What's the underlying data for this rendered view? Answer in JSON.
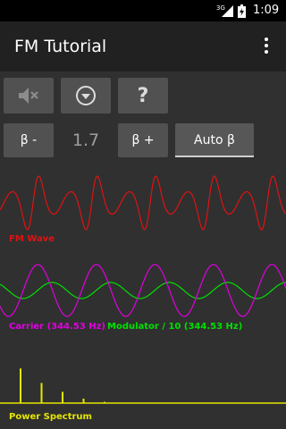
{
  "status_bar": {
    "network": "3G",
    "time": "1:09"
  },
  "app_bar": {
    "title": "FM Tutorial",
    "overflow_icon": "more-vert-icon"
  },
  "controls": {
    "mute_icon": "volume-off-icon",
    "menu_icon": "chevron-down-circle-icon",
    "help_label": "?",
    "beta_minus_label": "β -",
    "beta_value": "1.7",
    "beta_plus_label": "β +",
    "auto_beta_label": "Auto β"
  },
  "plots": {
    "fm_wave": {
      "label": "FM Wave",
      "color": "#e01212"
    },
    "carrier": {
      "label": "Carrier (344.53 Hz)",
      "color": "#e000e0"
    },
    "modulator": {
      "label": "Modulator / 10 (344.53 Hz)",
      "color": "#00e000"
    },
    "spectrum": {
      "label": "Power Spectrum",
      "color": "#e6e600",
      "bins": [
        0.86,
        0.5,
        0.28,
        0.11,
        0.03
      ]
    }
  },
  "colors": {
    "background": "#303030",
    "app_bar": "#212121",
    "button": "#515151"
  }
}
